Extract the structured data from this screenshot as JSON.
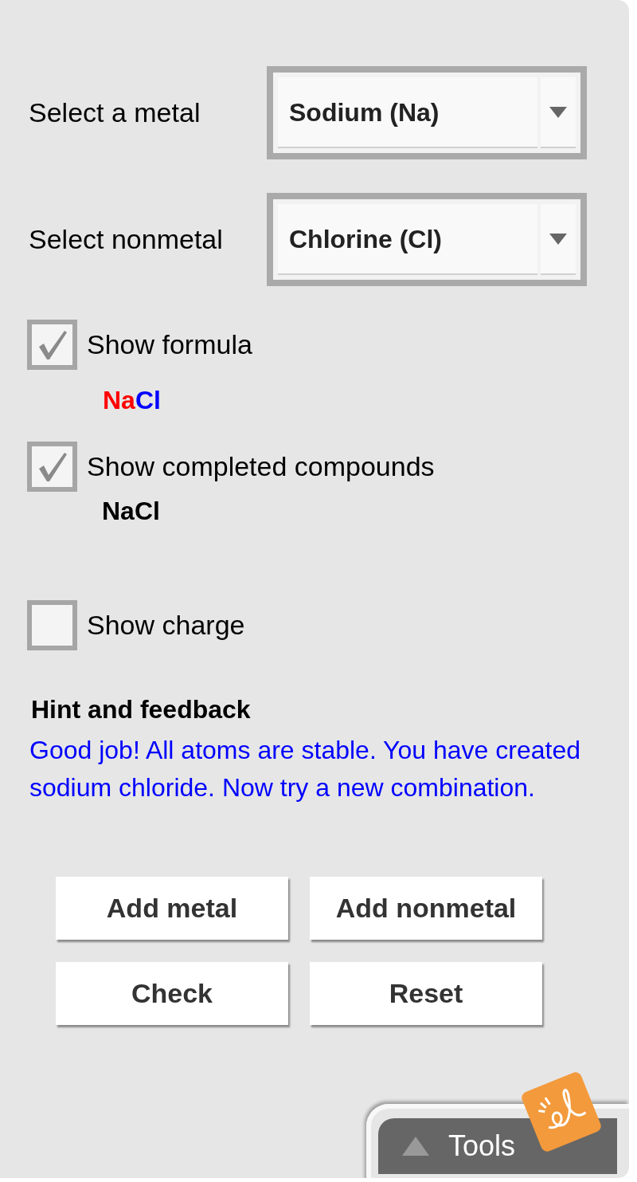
{
  "selects": [
    {
      "label": "Select a metal",
      "value": "Sodium (Na)"
    },
    {
      "label": "Select nonmetal",
      "value": "Chlorine (Cl)"
    }
  ],
  "show_formula": {
    "label": "Show formula",
    "checked": true,
    "formula": [
      {
        "text": "Na",
        "color": "#ff0000"
      },
      {
        "text": "Cl",
        "color": "#0000ff"
      }
    ]
  },
  "show_completed": {
    "label": "Show completed compounds",
    "checked": true,
    "compounds": [
      "NaCl"
    ]
  },
  "show_charge": {
    "label": "Show charge",
    "checked": false
  },
  "hint": {
    "heading": "Hint and feedback",
    "text": "Good job! All atoms are stable. You have created sodium chloride. Now try a new combination."
  },
  "buttons": [
    "Add metal",
    "Add nonmetal",
    "Check",
    "Reset"
  ],
  "tools_tab": {
    "label": "Tools"
  }
}
